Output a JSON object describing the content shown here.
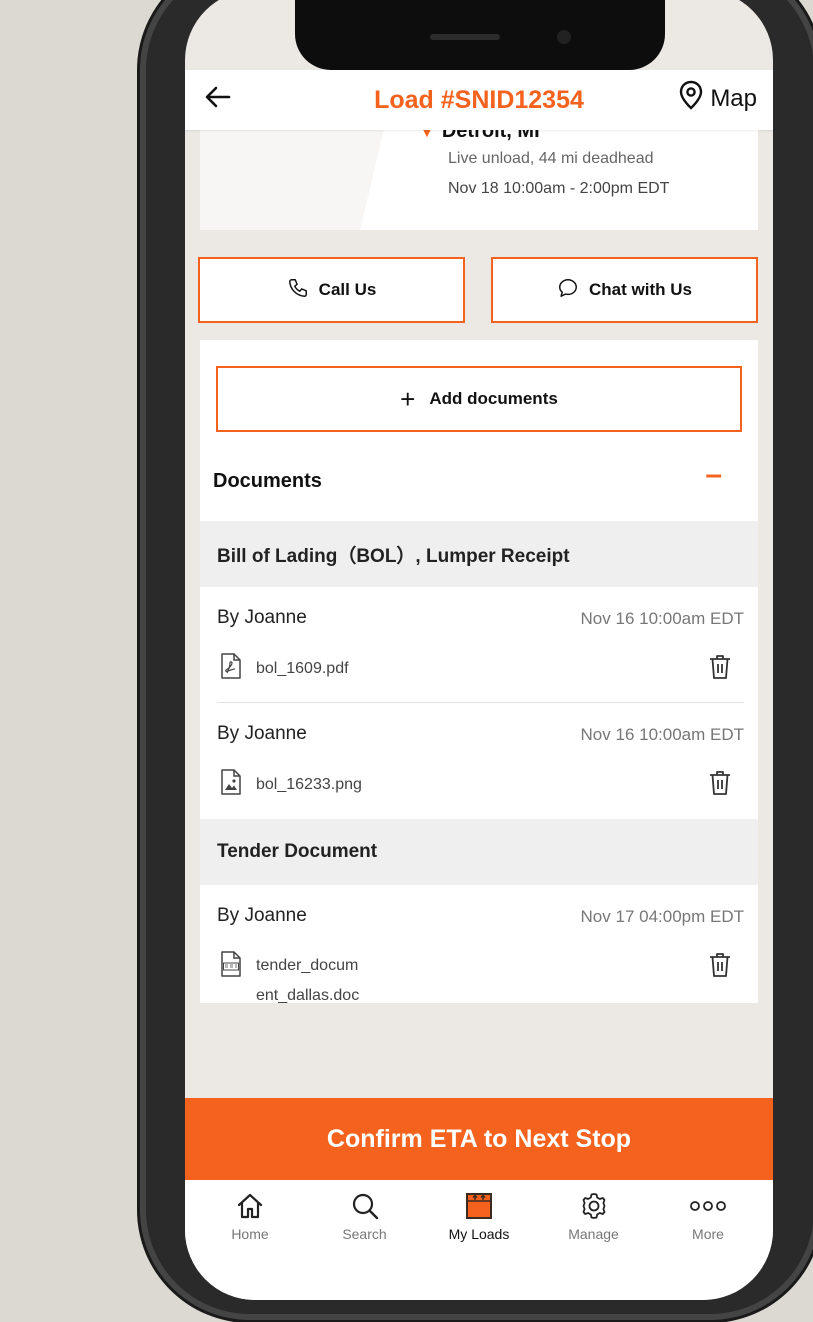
{
  "header": {
    "title": "Load #SNID12354",
    "map_label": "Map"
  },
  "stop": {
    "city": "Detroit, MI",
    "type": "Live unload, 44 mi deadhead",
    "time": "Nov 18  10:00am - 2:00pm EDT"
  },
  "actions": {
    "call_label": "Call Us",
    "chat_label": "Chat with Us"
  },
  "documents": {
    "add_label": "Add documents",
    "heading": "Documents",
    "collapse_symbol": "–",
    "groups": [
      {
        "title": "Bill of Lading（BOL）, Lumper Receipt",
        "entries": [
          {
            "by": "By Joanne",
            "date": "Nov 16  10:00am EDT",
            "file": "bol_1609.pdf",
            "icon": "pdf-file-icon"
          },
          {
            "by": "By Joanne",
            "date": "Nov 16  10:00am EDT",
            "file": "bol_16233.png",
            "icon": "image-file-icon"
          }
        ]
      },
      {
        "title": "Tender Document",
        "entries": [
          {
            "by": "By Joanne",
            "date": "Nov 17  04:00pm EDT",
            "file_line1": "tender_docum",
            "file_line2": "ent_dallas.doc",
            "icon": "doc-file-icon"
          }
        ]
      }
    ]
  },
  "cta": {
    "label": "Confirm ETA to Next Stop"
  },
  "tabbar": {
    "items": [
      {
        "label": "Home",
        "icon": "home-icon"
      },
      {
        "label": "Search",
        "icon": "search-icon"
      },
      {
        "label": "My Loads",
        "icon": "truck-loads-icon",
        "active": true
      },
      {
        "label": "Manage",
        "icon": "gear-icon"
      },
      {
        "label": "More",
        "icon": "more-dots-icon"
      }
    ]
  },
  "colors": {
    "accent": "#f4621e",
    "background": "#dcd8d2",
    "screen_bg": "#ece9e5"
  }
}
